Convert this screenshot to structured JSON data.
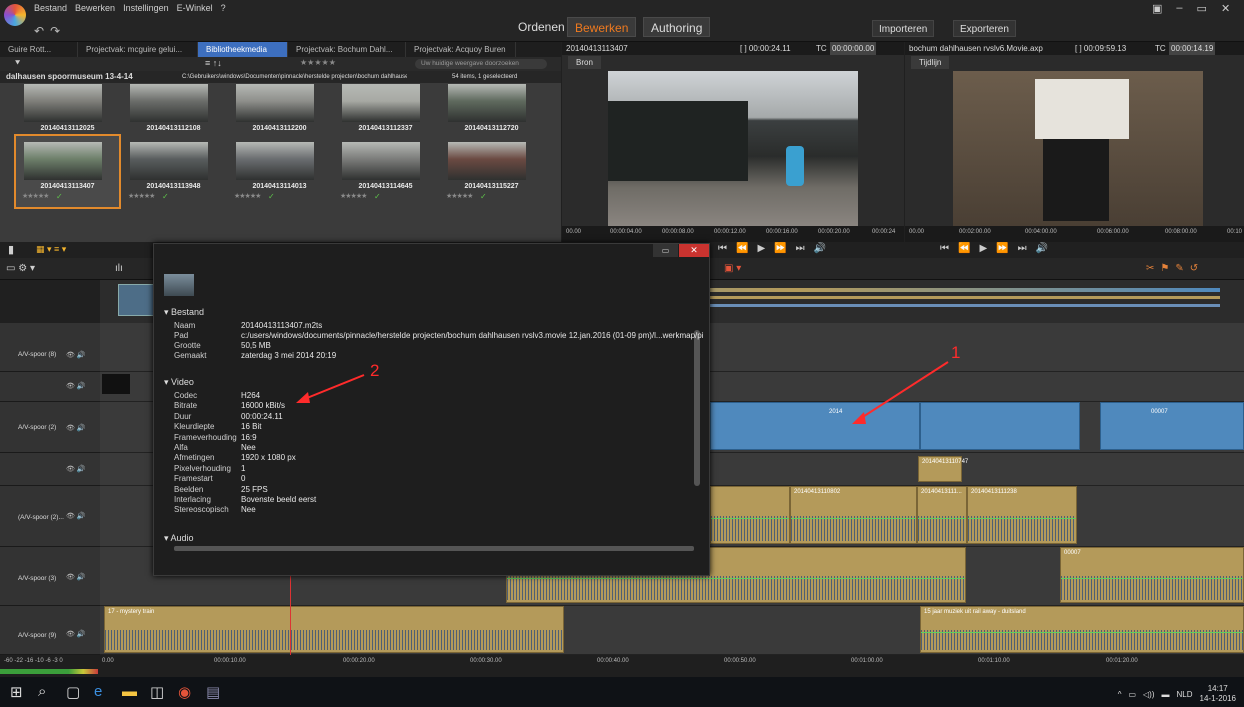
{
  "menu": [
    "Bestand",
    "Bewerken",
    "Instellingen",
    "E-Winkel"
  ],
  "modes": {
    "ordenen": "Ordenen",
    "bewerken": "Bewerken",
    "authoring": "Authoring"
  },
  "import_label": "Importeren",
  "export_label": "Exporteren",
  "library": {
    "tabs": [
      "Guire Rott...",
      "Projectvak: mcguire gelui...",
      "Bibliotheekmedia",
      "Projectvak: Bochum Dahl...",
      "Projectvak: Acquoy Buren"
    ],
    "active_tab": 2,
    "folder": "dalhausen spoormuseum 13-4-14",
    "path": "C:\\Gebruikers\\windows\\Documenten\\pinnacle\\herstelde projecten\\bochum dahlhausen rvslv...",
    "item_count": "54 items, 1 geselecteerd",
    "filter_placeholder": "Uw huidige weergave doorzoeken",
    "clips": [
      "20140413112025",
      "20140413112108",
      "20140413112200",
      "20140413112337",
      "20140413112720",
      "20140413113407",
      "20140413113948",
      "20140413114013",
      "20140413114645",
      "20140413115227"
    ],
    "selected": "20140413113407"
  },
  "source_preview": {
    "name": "20140413113407",
    "duration": "[ ] 00:00:24.11",
    "tc_label": "TC",
    "tc": "00:00:00.00",
    "tab": "Bron",
    "ruler": [
      "00.00",
      "00:00:04.00",
      "00:00:08.00",
      "00:00:12.00",
      "00:00:16.00",
      "00:00:20.00",
      "00:00:24"
    ]
  },
  "timeline_preview": {
    "name": "bochum dahlhausen rvslv6.Movie.axp",
    "duration": "[ ] 00:09:59.13",
    "tc_label": "TC",
    "tc": "00:00:14.19",
    "tab": "Tijdlijn",
    "ruler": [
      "00.00",
      "00:02:00.00",
      "00:04:00.00",
      "00:06:00.00",
      "00:08:00.00",
      "00:10"
    ]
  },
  "tracks": [
    {
      "label": "A/V-spoor (8)"
    },
    {
      "label": ""
    },
    {
      "label": "A/V-spoor (2)"
    },
    {
      "label": ""
    },
    {
      "label": "(A/V-spoor (2)..."
    },
    {
      "label": "A/V-spoor (3)"
    },
    {
      "label": "A/V-spoor (9)"
    }
  ],
  "clips_on_timeline": {
    "v1": "2014",
    "v2": "00007",
    "v3": "20140413110747",
    "a1": "20140413110802",
    "a2": "20140413111...",
    "a3": "20140413111238",
    "a4": "00007",
    "music1": "17 - mystery train",
    "music2": "15 jaar muziek uit rail away - duitsland"
  },
  "ruler_labels": [
    "0.00",
    "00:00:10.00",
    "00:00:20.00",
    "00:00:30.00",
    "00:00:40.00",
    "00:00:50.00",
    "00:01:00.00",
    "00:01:10.00",
    "00:01:20.00"
  ],
  "meter_labels": "-60  -22 -16  -10  -6  -3  0",
  "info": {
    "section_file": "Bestand",
    "file_rows": [
      {
        "k": "Naam",
        "v": "20140413113407.m2ts"
      },
      {
        "k": "Pad",
        "v": "c:/users/windows/documents/pinnacle/herstelde projecten/bochum dahlhausen rvslv3.movie 12.jan.2016 (01-09 pm)/l...werkmap/pi"
      },
      {
        "k": "Grootte",
        "v": "50,5 MB"
      },
      {
        "k": "Gemaakt",
        "v": "zaterdag 3 mei 2014 20:19"
      }
    ],
    "section_video": "Video",
    "video_rows": [
      {
        "k": "Codec",
        "v": "H264"
      },
      {
        "k": "Bitrate",
        "v": "16000 kBit/s"
      },
      {
        "k": "Duur",
        "v": "00:00:24.11"
      },
      {
        "k": "Kleurdiepte",
        "v": "16 Bit"
      },
      {
        "k": "Frameverhouding",
        "v": "16:9"
      },
      {
        "k": "Alfa",
        "v": "Nee"
      },
      {
        "k": "Afmetingen",
        "v": "1920 x 1080 px"
      },
      {
        "k": "Pixelverhouding",
        "v": "1"
      },
      {
        "k": "Framestart",
        "v": "0"
      },
      {
        "k": "Beelden",
        "v": "25 FPS"
      },
      {
        "k": "Interlacing",
        "v": "Bovenste beeld eerst"
      },
      {
        "k": "Stereoscopisch",
        "v": "Nee"
      }
    ],
    "section_audio": "Audio"
  },
  "annotations": {
    "a1": "1",
    "a2": "2"
  },
  "tray": {
    "lang": "NLD",
    "time": "14:17",
    "date": "14-1-2016"
  }
}
